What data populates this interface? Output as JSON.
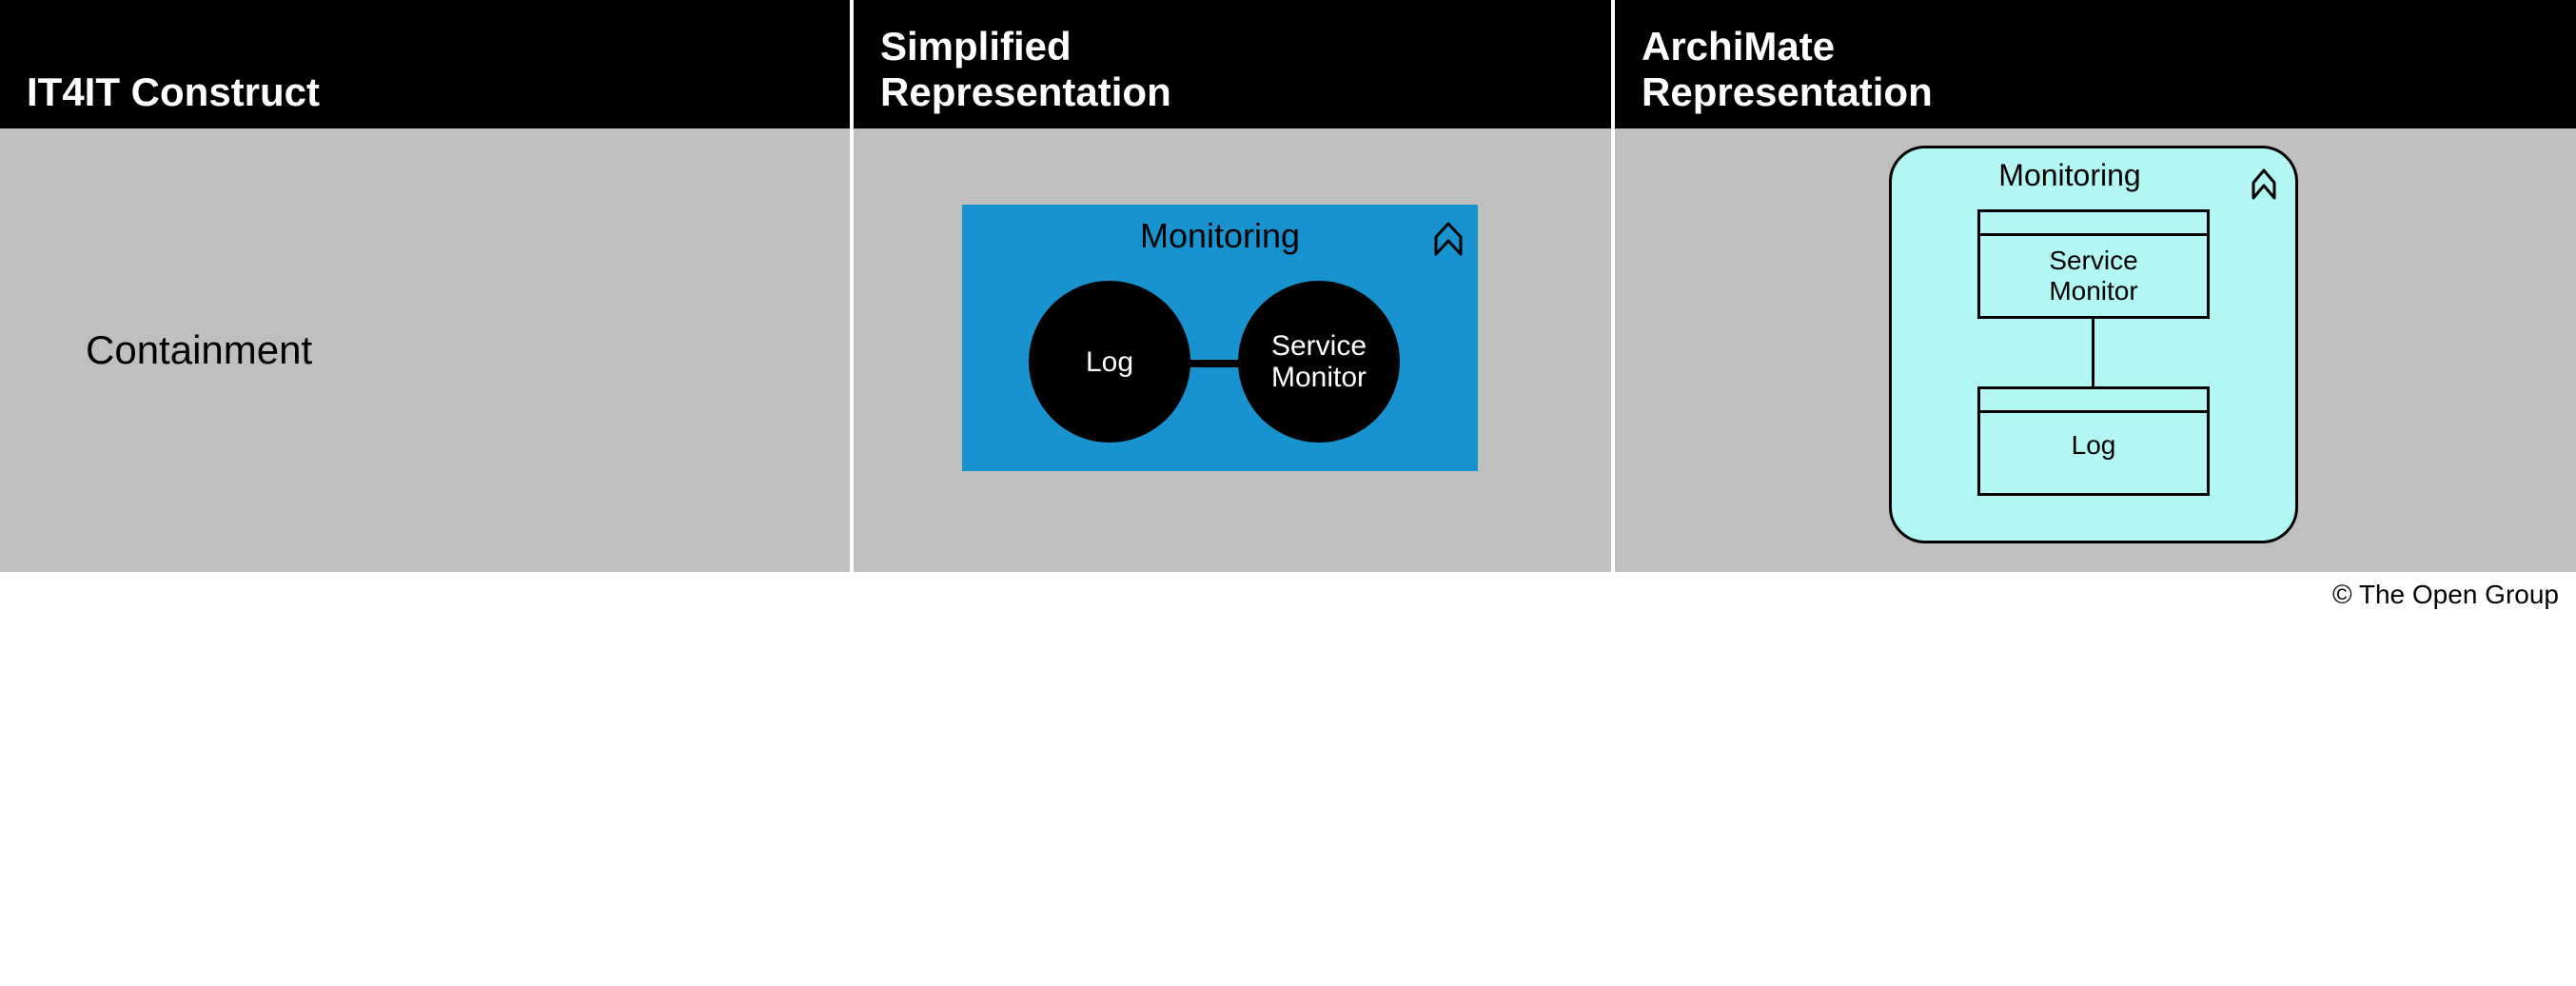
{
  "headers": {
    "col1": "IT4IT Construct",
    "col2": "Simplified\nRepresentation",
    "col3": "ArchiMate\nRepresentation"
  },
  "row": {
    "construct": "Containment",
    "simplified": {
      "container_label": "Monitoring",
      "node1": "Log",
      "node2": "Service\nMonitor",
      "icon": "function-icon"
    },
    "archimate": {
      "container_label": "Monitoring",
      "box1": "Service\nMonitor",
      "box2": "Log",
      "icon": "function-icon"
    }
  },
  "copyright": "© The Open Group",
  "colors": {
    "simplified_bg": "#1893cf",
    "archimate_bg": "#b2f7f3",
    "cell_bg": "#bfbfbf"
  }
}
